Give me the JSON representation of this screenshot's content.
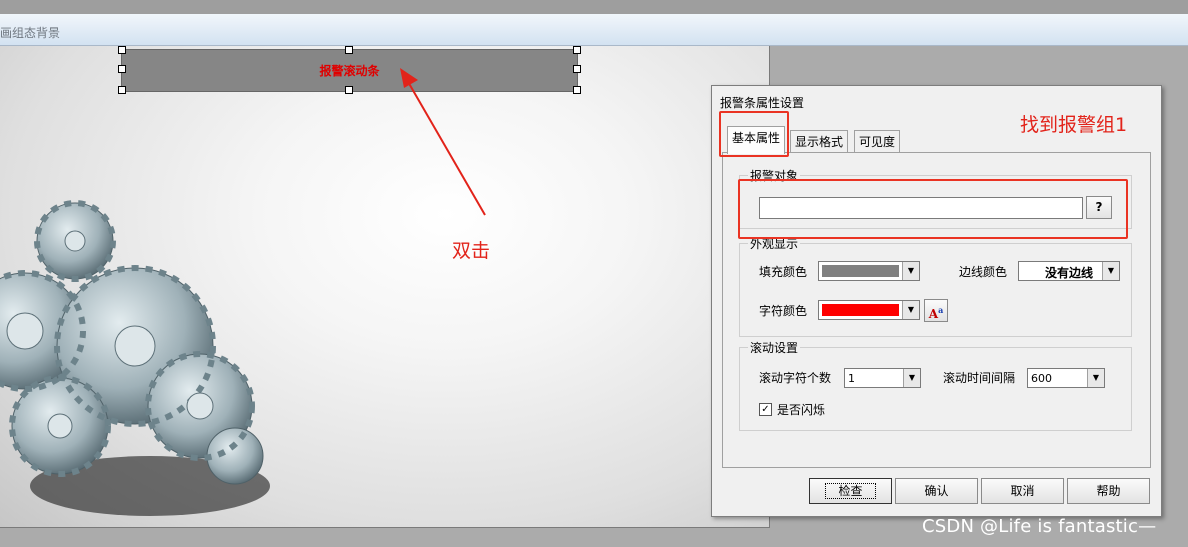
{
  "window": {
    "title": "画组态背景"
  },
  "canvas": {
    "alarm_bar_text": "报警滚动条",
    "annotation_double_click": "双击"
  },
  "dialog": {
    "title": "报警条属性设置",
    "tabs": [
      {
        "label": "基本属性",
        "active": true
      },
      {
        "label": "显示格式",
        "active": false
      },
      {
        "label": "可见度",
        "active": false
      }
    ],
    "annotation_find": "找到报警组1",
    "alarm_object": {
      "legend": "报警对象",
      "value": "",
      "browse_label": "?"
    },
    "appearance": {
      "legend": "外观显示",
      "fill_color_label": "填充颜色",
      "fill_color": "#808080",
      "border_color_label": "边线颜色",
      "border_color_value": "没有边线",
      "text_color_label": "字符颜色",
      "text_color": "#ff0000",
      "font_button_icon": "font-icon"
    },
    "scroll": {
      "legend": "滚动设置",
      "chars_label": "滚动字符个数",
      "chars_value": "1",
      "interval_label": "滚动时间间隔",
      "interval_value": "600",
      "blink_label": "是否闪烁",
      "blink_checked": true
    },
    "buttons": {
      "check": "检查",
      "ok": "确认",
      "cancel": "取消",
      "help": "帮助"
    }
  },
  "watermark": "CSDN @Life is fantastic—"
}
